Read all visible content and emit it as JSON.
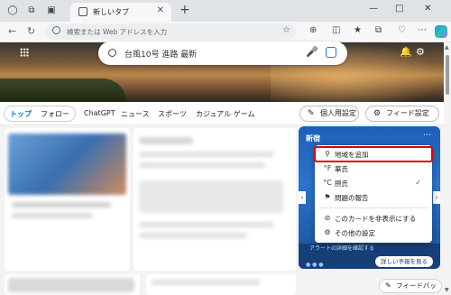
{
  "browser": {
    "tab_title": "新しいタブ",
    "omnibox_placeholder": "検索または Web アドレスを入力"
  },
  "hero": {
    "search_query": "台風10号 進路 最新"
  },
  "feed_nav": {
    "tabs": [
      "トップ",
      "フォロー",
      "ChatGPT",
      "ニュース",
      "スポーツ",
      "カジュアル ゲーム"
    ],
    "personalize_label": "個人用設定",
    "feed_settings_label": "フィード設定"
  },
  "weather": {
    "location": "新宿",
    "detail_button": "詳しい予報を見る",
    "alert_text": "アラートの詳細を確認する"
  },
  "menu": {
    "items": [
      {
        "label": "地域を追加",
        "icon": "location-add-icon"
      },
      {
        "label": "華氏",
        "icon": "fahrenheit-icon"
      },
      {
        "label": "摂氏",
        "icon": "celsius-icon",
        "checked": true
      },
      {
        "label": "問題の報告",
        "icon": "flag-icon"
      },
      {
        "label": "このカードを非表示にする",
        "icon": "hide-icon"
      },
      {
        "label": "その他の設定",
        "icon": "gear-icon"
      }
    ],
    "fahrenheit_symbol": "°F",
    "celsius_symbol": "°C"
  },
  "feedback_label": "フィードバック",
  "colors": {
    "accent": "#0f6cbd",
    "highlight_outline": "#e00000",
    "weather_card": "#2b74cf"
  }
}
